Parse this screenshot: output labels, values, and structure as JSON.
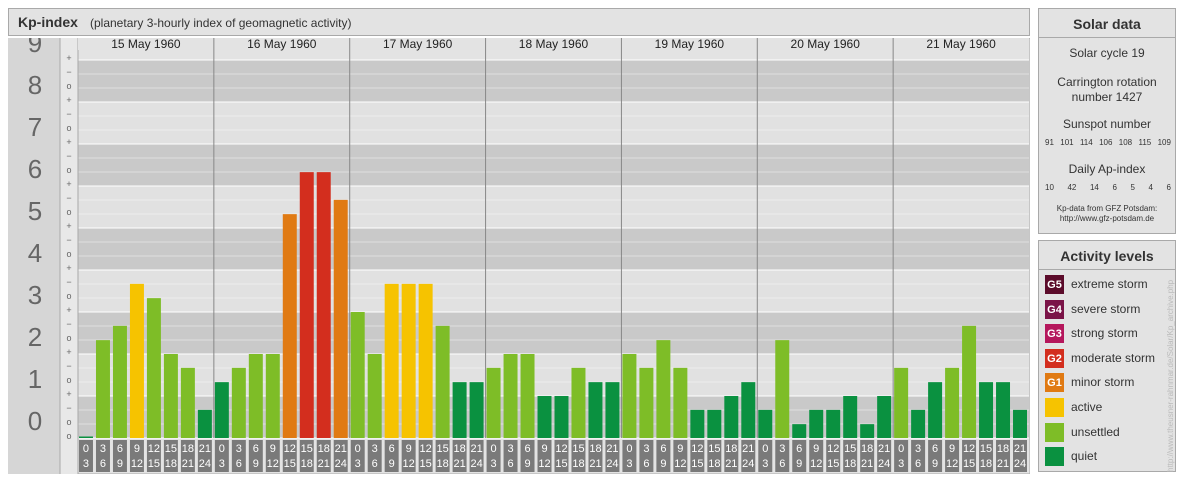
{
  "header": {
    "title": "Kp-index",
    "subtitle": "(planetary 3-hourly index of geomagnetic activity)"
  },
  "chart_data": {
    "type": "bar",
    "ylabel": "",
    "ylim": [
      0,
      9
    ],
    "y_ticks": [
      "0",
      "1",
      "2",
      "3",
      "4",
      "5",
      "6",
      "7",
      "8",
      "9"
    ],
    "minor_labels": [
      "+",
      "−",
      "o",
      "+",
      "−",
      "o",
      "+",
      "−",
      "o",
      "+",
      "−",
      "o",
      "+",
      "−",
      "o",
      "+",
      "−",
      "o",
      "+",
      "−",
      "o",
      "+",
      "−",
      "o",
      "+",
      "−",
      "o",
      "o"
    ],
    "days": [
      "15 May 1960",
      "16 May 1960",
      "17 May 1960",
      "18 May 1960",
      "19 May 1960",
      "20 May 1960",
      "21 May 1960"
    ],
    "hour_starts": [
      "0",
      "3",
      "6",
      "9",
      "12",
      "15",
      "18",
      "21"
    ],
    "hour_ends": [
      "3",
      "6",
      "9",
      "12",
      "15",
      "18",
      "21",
      "24"
    ],
    "values": [
      0.0,
      2.33,
      2.67,
      3.67,
      3.33,
      2.0,
      1.67,
      0.67,
      1.33,
      1.67,
      2.0,
      2.0,
      5.33,
      6.33,
      6.33,
      5.67,
      3.0,
      2.0,
      3.67,
      3.67,
      3.67,
      2.67,
      1.33,
      1.33,
      1.67,
      2.0,
      2.0,
      1.0,
      1.0,
      1.67,
      1.33,
      1.33,
      2.0,
      1.67,
      2.33,
      1.67,
      0.67,
      0.67,
      1.0,
      1.33,
      0.67,
      2.33,
      0.33,
      0.67,
      0.67,
      1.0,
      0.33,
      1.0,
      1.67,
      0.67,
      1.33,
      1.67,
      2.67,
      1.33,
      1.33,
      0.67
    ],
    "colors": {
      "quiet": "#0a9140",
      "unsettled": "#7ebd27",
      "active": "#f6c300",
      "minor": "#e07a13",
      "moderate": "#d32e1e"
    },
    "grid": true
  },
  "solar": {
    "title": "Solar data",
    "cycle": "Solar cycle 19",
    "carrington_1": "Carrington rotation",
    "carrington_2": "number 1427",
    "sunspot_label": "Sunspot number",
    "sunspot_values": [
      "91",
      "101",
      "114",
      "106",
      "108",
      "115",
      "109"
    ],
    "ap_label": "Daily Ap-index",
    "ap_values": [
      "10",
      "42",
      "14",
      "6",
      "5",
      "4",
      "6"
    ],
    "source_1": "Kp-data from GFZ Potsdam:",
    "source_2": "http://www.gfz-potsdam.de"
  },
  "levels": {
    "title": "Activity levels",
    "items": [
      {
        "code": "G5",
        "label": "extreme storm",
        "color": "#5b0b2a"
      },
      {
        "code": "G4",
        "label": "severe storm",
        "color": "#7a1347"
      },
      {
        "code": "G3",
        "label": "strong storm",
        "color": "#b5175c"
      },
      {
        "code": "G2",
        "label": "moderate storm",
        "color": "#d32e1e"
      },
      {
        "code": "G1",
        "label": "minor storm",
        "color": "#e07a13"
      },
      {
        "code": "",
        "label": "active",
        "color": "#f6c300"
      },
      {
        "code": "",
        "label": "unsettled",
        "color": "#7ebd27"
      },
      {
        "code": "",
        "label": "quiet",
        "color": "#0a9140"
      }
    ]
  },
  "watermark": "http://www.theusner-rahnmar.de/Solar/Kp_archive.php"
}
